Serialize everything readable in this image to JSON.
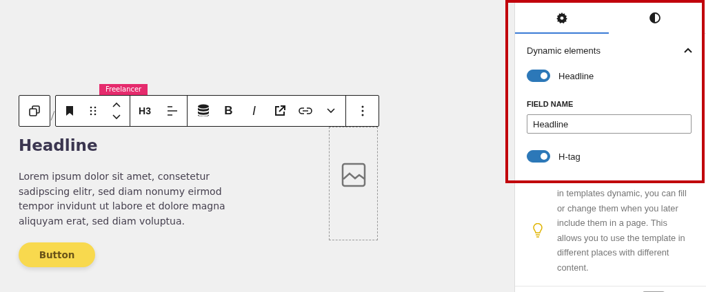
{
  "block_toolbar": {
    "badge": "Freelancer",
    "groups": [
      [
        {
          "kind": "bookmark"
        },
        {
          "kind": "drag"
        },
        {
          "kind": "move"
        }
      ],
      [
        {
          "kind": "heading",
          "label": "H3"
        },
        {
          "kind": "align"
        }
      ],
      [
        {
          "kind": "database"
        },
        {
          "kind": "bold",
          "label": "B"
        },
        {
          "kind": "italic",
          "label": "I"
        },
        {
          "kind": "external"
        },
        {
          "kind": "link"
        },
        {
          "kind": "more"
        }
      ],
      [
        {
          "kind": "options"
        }
      ]
    ]
  },
  "content": {
    "headline": "Headline",
    "paragraph": "Lorem ipsum dolor sit amet, consetetur sadipscing elitr, sed diam nonumy eirmod tempor invidunt ut labore et dolore magna aliquyam erat, sed diam voluptua.",
    "button": "Button"
  },
  "sidebar": {
    "tabs": [
      {
        "kind": "settings",
        "selected": true
      },
      {
        "kind": "styles",
        "selected": false
      }
    ],
    "section": {
      "title": "Dynamic elements",
      "expanded": true
    },
    "toggles": [
      {
        "label": "Headline",
        "on": true
      },
      {
        "label": "H-tag",
        "on": true
      }
    ],
    "field": {
      "label": "FIELD NAME",
      "value": "Headline"
    },
    "hint": "in templates dynamic, you can fill or change them when you later include them in a page. This allows you to use the template in different places with different content."
  }
}
